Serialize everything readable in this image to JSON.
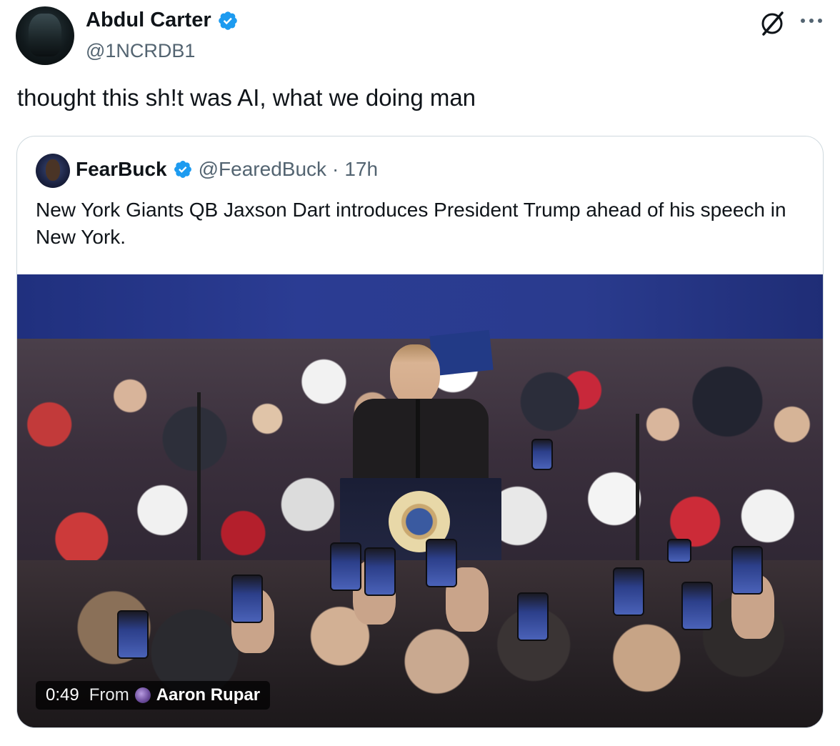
{
  "tweet": {
    "author": {
      "display_name": "Abdul Carter",
      "handle": "@1NCRDB1",
      "verified": true
    },
    "text": "thought this sh!t was AI, what we doing man",
    "icons": {
      "grok": "grok-icon",
      "more": "more-icon"
    }
  },
  "quote": {
    "author": {
      "display_name": "FearBuck",
      "handle": "@FearedBuck",
      "verified": true
    },
    "separator": "·",
    "time": "17h",
    "text": "New York Giants QB Jaxson Dart introduces President Trump ahead of his speech in New York.",
    "media": {
      "type": "video",
      "duration": "0:49",
      "from_label": "From",
      "source_name": "Aaron Rupar"
    }
  },
  "colors": {
    "text_primary": "#0f1419",
    "text_secondary": "#536471",
    "verified_blue": "#1d9bf0",
    "border": "#cfd9de"
  }
}
